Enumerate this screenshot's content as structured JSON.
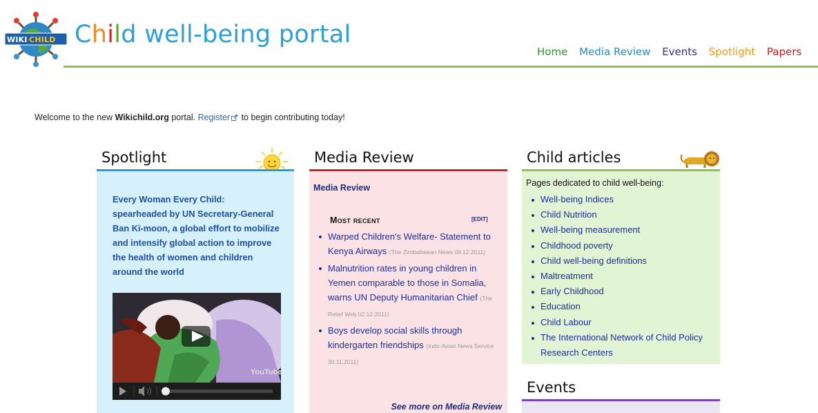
{
  "header": {
    "logo_text": "WIKICHILD",
    "title_parts": [
      "C",
      "h",
      "i",
      "l",
      "d",
      " well-being portal"
    ]
  },
  "topnav": {
    "items": [
      "Home",
      "Media Review",
      "Events",
      "Spotlight",
      "Papers"
    ]
  },
  "welcome": {
    "pre": "Welcome to the new ",
    "site": "Wikichild.org",
    "mid": " portal. ",
    "register": "Register",
    "post": " to begin contributing today!"
  },
  "spotlight": {
    "heading": "Spotlight",
    "text": "Every Woman Every Child: spearheaded by UN Secretary-General Ban Ki-moon, a global effort to mobilize and intensify global action to improve the health of women and children around the world",
    "video_brand": "YouTube"
  },
  "media_review": {
    "heading": "Media Review",
    "link": "Media Review",
    "section_title": "Most recent",
    "edit_label": "[EDIT]",
    "items": [
      {
        "title": "Warped Children's Welfare- Statement to Kenya Airways",
        "source": "(The Zimbabwean News 09.12.2011)"
      },
      {
        "title": "Malnutrition rates in young children in Yemen comparable to those in Somalia, warns UN Deputy Humanitarian Chief",
        "source": "(The Relief Web 02.12.2011)"
      },
      {
        "title": "Boys develop social skills through kindergarten friendships",
        "source": "(Indo-Asian News Service 30.11.2011)"
      }
    ],
    "see_more": "See more on Media Review"
  },
  "child_articles": {
    "heading": "Child articles",
    "intro": "Pages dedicated to child well-being:",
    "items": [
      "Well-being Indices",
      "Child Nutrition",
      "Well-being measurement",
      "Childhood poverty",
      "Child well-being definitions",
      "Maltreatment",
      "Early Childhood",
      "Education",
      "Child Labour",
      "The International Network of Child Policy Research Centers"
    ]
  },
  "events": {
    "heading": "Events"
  },
  "colors": {
    "green": "#8cc152",
    "blue": "#1da0dc",
    "red": "#c1272d",
    "purple": "#7b3fbf",
    "link": "#1f2d9e"
  }
}
